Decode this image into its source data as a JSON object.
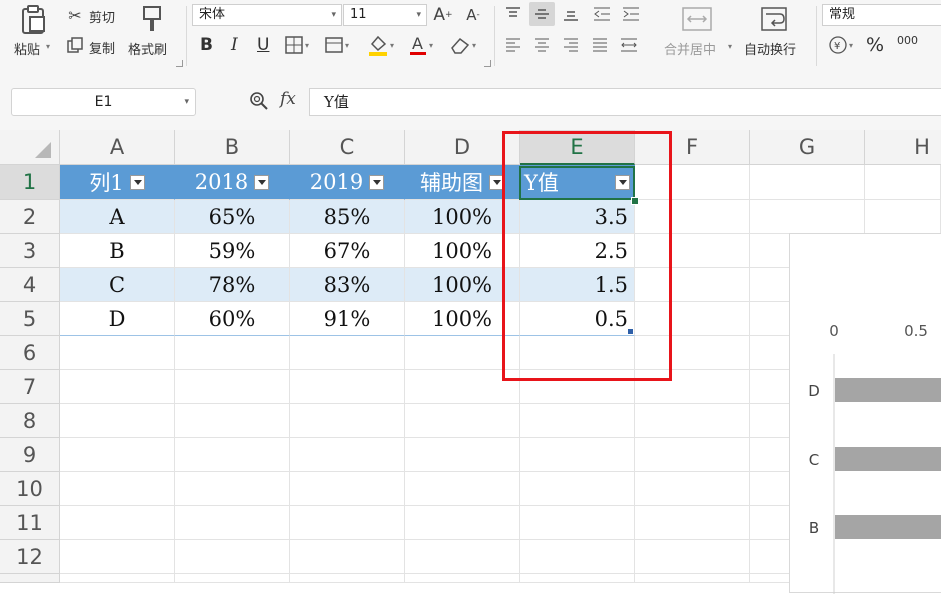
{
  "ribbon": {
    "paste": "粘贴",
    "cut": "剪切",
    "copy": "复制",
    "format_painter": "格式刷",
    "font_name": "宋体",
    "font_size": "11",
    "bold": "B",
    "italic": "I",
    "underline": "U",
    "merge_center": "合并居中",
    "wrap_text": "自动换行",
    "number_format": "常规",
    "percent": "%",
    "thousands": "000"
  },
  "formula_bar": {
    "name_box": "E1",
    "fx_label": "fx",
    "content": "Y值"
  },
  "columns": [
    "A",
    "B",
    "C",
    "D",
    "E",
    "F",
    "G",
    "H"
  ],
  "rows": [
    "1",
    "2",
    "3",
    "4",
    "5",
    "6",
    "7",
    "8",
    "9",
    "10",
    "11",
    "12"
  ],
  "table": {
    "headers": [
      "列1",
      "2018",
      "2019",
      "辅助图",
      "Y值"
    ],
    "rows": [
      [
        "A",
        "65%",
        "85%",
        "100%",
        "3.5"
      ],
      [
        "B",
        "59%",
        "67%",
        "100%",
        "2.5"
      ],
      [
        "C",
        "78%",
        "83%",
        "100%",
        "1.5"
      ],
      [
        "D",
        "60%",
        "91%",
        "100%",
        "0.5"
      ]
    ]
  },
  "chart": {
    "x_ticks": [
      "0",
      "0.5"
    ],
    "categories": [
      "D",
      "C",
      "B"
    ],
    "bar_color": "#a5a5a5"
  },
  "colors": {
    "header_blue": "#5b9bd5",
    "band_blue": "#ddebf7",
    "select_green": "#217346",
    "highlight_red": "#e8141a"
  }
}
